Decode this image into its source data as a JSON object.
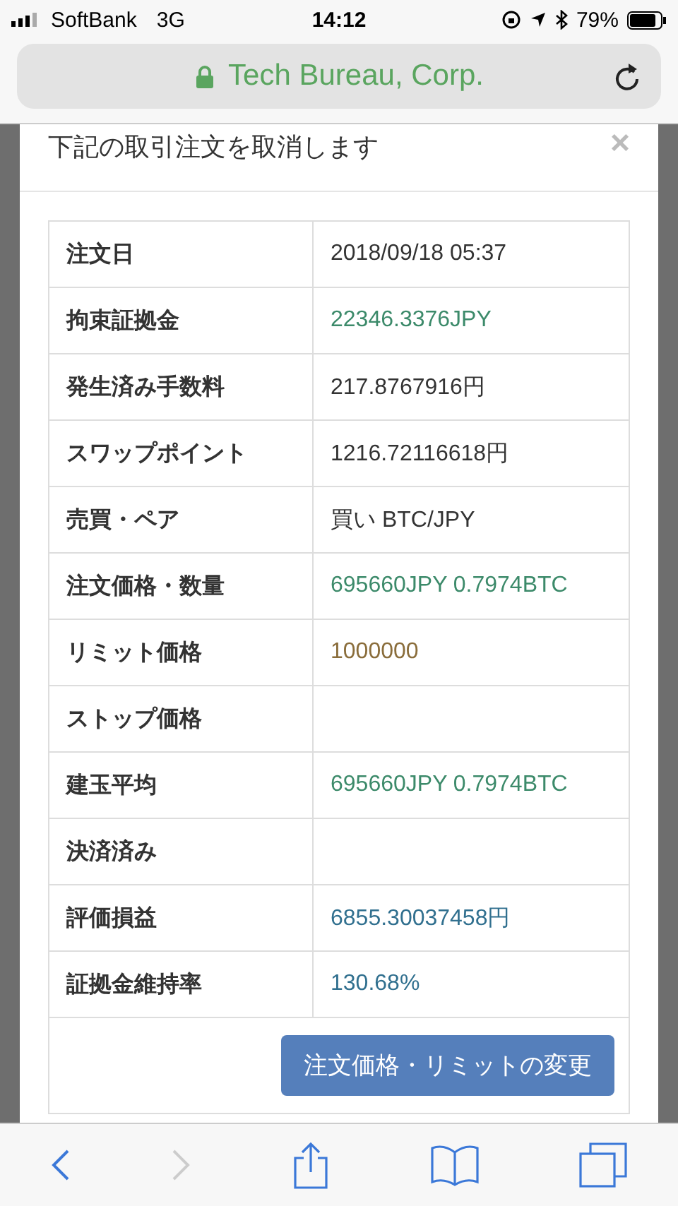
{
  "status_bar": {
    "carrier": "SoftBank",
    "network": "3G",
    "time": "14:12",
    "battery": "79%"
  },
  "address_bar": {
    "site": "Tech Bureau, Corp."
  },
  "dialog": {
    "title": "下記の取引注文を取消します",
    "close": "×",
    "rows": [
      {
        "label": "注文日",
        "value": "2018/09/18 05:37",
        "color": "#333333"
      },
      {
        "label": "拘束証拠金",
        "value": "22346.3376JPY",
        "color": "#3c8a6a"
      },
      {
        "label": "発生済み手数料",
        "value": "217.8767916円",
        "color": "#333333"
      },
      {
        "label": "スワップポイント",
        "value": "1216.72116618円",
        "color": "#333333"
      },
      {
        "label": "売買・ペア",
        "value": "買い BTC/JPY",
        "color": "#333333"
      },
      {
        "label": "注文価格・数量",
        "value": "695660JPY 0.7974BTC",
        "color": "#3c8a6a"
      },
      {
        "label": "リミット価格",
        "value": "1000000",
        "color": "#8a6d3b"
      },
      {
        "label": "ストップ価格"
      },
      {
        "label": "建玉平均",
        "value": "695660JPY 0.7974BTC",
        "color": "#3c8a6a"
      },
      {
        "label": "決済済み"
      },
      {
        "label": "評価損益",
        "value": "6855.30037458円",
        "color": "#31708f"
      },
      {
        "label": "証拠金維持率",
        "value": "130.68%",
        "color": "#31708f"
      }
    ],
    "button": "注文価格・リミットの変更"
  }
}
